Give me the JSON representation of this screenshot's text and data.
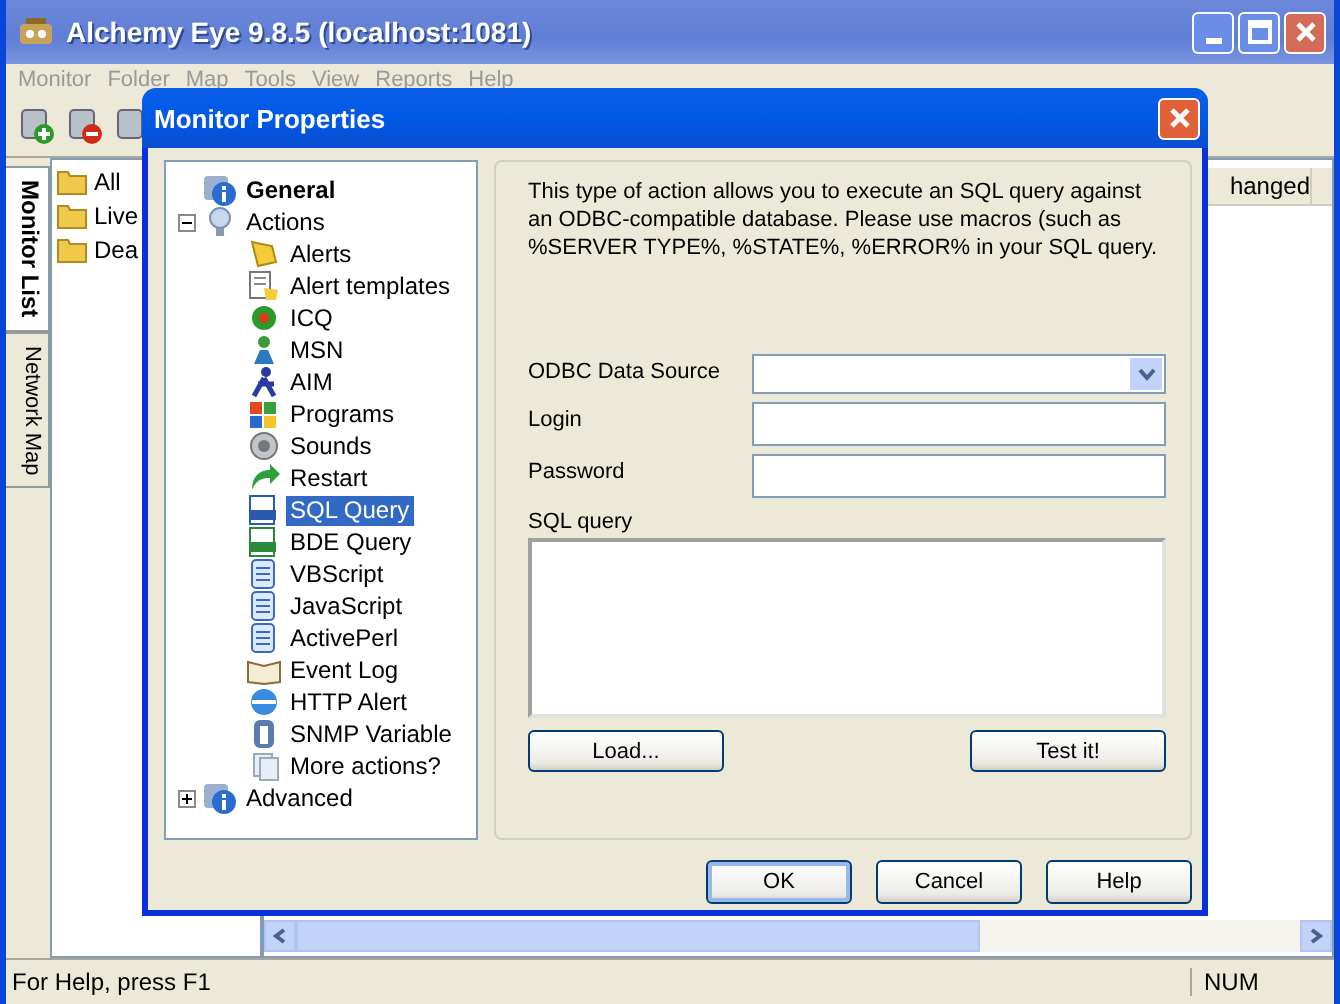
{
  "window": {
    "title": "Alchemy Eye 9.8.5 (localhost:1081)"
  },
  "menu": [
    "Monitor",
    "Folder",
    "Map",
    "Tools",
    "View",
    "Reports",
    "Help"
  ],
  "side_tabs": [
    {
      "label": "Monitor List",
      "selected": true
    },
    {
      "label": "Network Map",
      "selected": false
    }
  ],
  "folders": [
    "All",
    "Live",
    "Dea"
  ],
  "list": {
    "columns": [
      "hanged"
    ]
  },
  "dialog": {
    "title": "Monitor Properties",
    "tree": [
      {
        "label": "General",
        "bold": true,
        "selected": false
      },
      {
        "label": "Actions",
        "bold": false,
        "selected": false,
        "expanded": true,
        "children": [
          {
            "label": "Alerts",
            "selected": false
          },
          {
            "label": "Alert templates",
            "selected": false
          },
          {
            "label": "ICQ",
            "selected": false
          },
          {
            "label": "MSN",
            "selected": false
          },
          {
            "label": "AIM",
            "selected": false
          },
          {
            "label": "Programs",
            "selected": false
          },
          {
            "label": "Sounds",
            "selected": false
          },
          {
            "label": "Restart",
            "selected": false
          },
          {
            "label": "SQL Query",
            "selected": true
          },
          {
            "label": "BDE Query",
            "selected": false
          },
          {
            "label": "VBScript",
            "selected": false
          },
          {
            "label": "JavaScript",
            "selected": false
          },
          {
            "label": "ActivePerl",
            "selected": false
          },
          {
            "label": "Event Log",
            "selected": false
          },
          {
            "label": "HTTP Alert",
            "selected": false
          },
          {
            "label": "SNMP Variable",
            "selected": false
          },
          {
            "label": "More actions?",
            "selected": false
          }
        ]
      },
      {
        "label": "Advanced",
        "bold": false,
        "selected": false,
        "expanded": false
      }
    ],
    "description": "This type of action allows you to execute an SQL query against an ODBC-compatible database. Please use macros (such as %SERVER TYPE%, %STATE%, %ERROR% in your SQL query.",
    "fields": [
      {
        "kind": "dropdown",
        "label": "ODBC Data Source"
      },
      {
        "kind": "text",
        "label": "Login"
      },
      {
        "kind": "password",
        "label": "Password"
      }
    ],
    "query_label": "SQL query",
    "panel_buttons": [
      "Load...",
      "Test it!"
    ],
    "buttons": [
      {
        "label": "OK",
        "default": true
      },
      {
        "label": "Cancel",
        "default": false
      },
      {
        "label": "Help",
        "default": false
      }
    ]
  },
  "status_bar": {
    "text": "For Help, press F1",
    "panes": [
      "NUM"
    ]
  }
}
